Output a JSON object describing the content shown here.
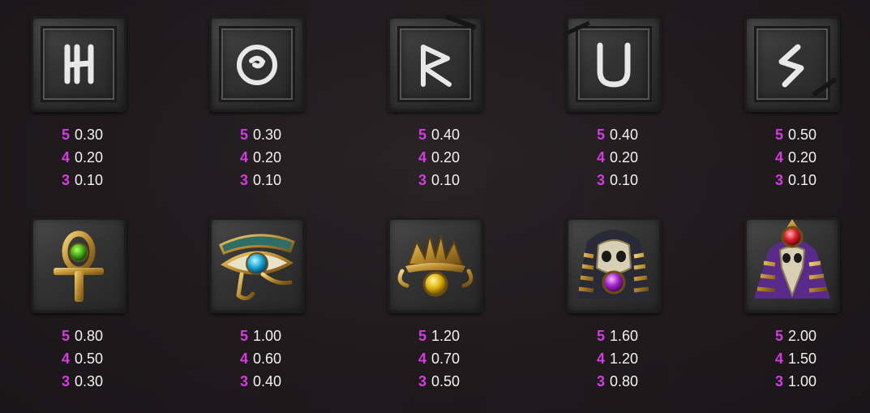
{
  "accent_color": "#d43be0",
  "text_color": "#f2f2f2",
  "rows": [
    {
      "symbols": [
        {
          "icon": "rune-h-icon",
          "glyph": "H",
          "payouts": [
            {
              "count": "5",
              "value": "0.30"
            },
            {
              "count": "4",
              "value": "0.20"
            },
            {
              "count": "3",
              "value": "0.10"
            }
          ]
        },
        {
          "icon": "rune-o-icon",
          "glyph": "O",
          "payouts": [
            {
              "count": "5",
              "value": "0.30"
            },
            {
              "count": "4",
              "value": "0.20"
            },
            {
              "count": "3",
              "value": "0.10"
            }
          ]
        },
        {
          "icon": "rune-r-icon",
          "glyph": "R",
          "payouts": [
            {
              "count": "5",
              "value": "0.40"
            },
            {
              "count": "4",
              "value": "0.20"
            },
            {
              "count": "3",
              "value": "0.10"
            }
          ]
        },
        {
          "icon": "rune-u-icon",
          "glyph": "U",
          "payouts": [
            {
              "count": "5",
              "value": "0.40"
            },
            {
              "count": "4",
              "value": "0.20"
            },
            {
              "count": "3",
              "value": "0.10"
            }
          ]
        },
        {
          "icon": "rune-s-icon",
          "glyph": "S",
          "payouts": [
            {
              "count": "5",
              "value": "0.50"
            },
            {
              "count": "4",
              "value": "0.20"
            },
            {
              "count": "3",
              "value": "0.10"
            }
          ]
        }
      ]
    },
    {
      "symbols": [
        {
          "icon": "ankh-icon",
          "payouts": [
            {
              "count": "5",
              "value": "0.80"
            },
            {
              "count": "4",
              "value": "0.50"
            },
            {
              "count": "3",
              "value": "0.30"
            }
          ]
        },
        {
          "icon": "eye-of-horus-icon",
          "payouts": [
            {
              "count": "5",
              "value": "1.00"
            },
            {
              "count": "4",
              "value": "0.60"
            },
            {
              "count": "3",
              "value": "0.40"
            }
          ]
        },
        {
          "icon": "scarab-fan-icon",
          "payouts": [
            {
              "count": "5",
              "value": "1.20"
            },
            {
              "count": "4",
              "value": "0.70"
            },
            {
              "count": "3",
              "value": "0.50"
            }
          ]
        },
        {
          "icon": "pharaoh-skull-icon",
          "payouts": [
            {
              "count": "5",
              "value": "1.60"
            },
            {
              "count": "4",
              "value": "1.20"
            },
            {
              "count": "3",
              "value": "0.80"
            }
          ]
        },
        {
          "icon": "bird-skull-pharaoh-icon",
          "payouts": [
            {
              "count": "5",
              "value": "2.00"
            },
            {
              "count": "4",
              "value": "1.50"
            },
            {
              "count": "3",
              "value": "1.00"
            }
          ]
        }
      ]
    }
  ]
}
